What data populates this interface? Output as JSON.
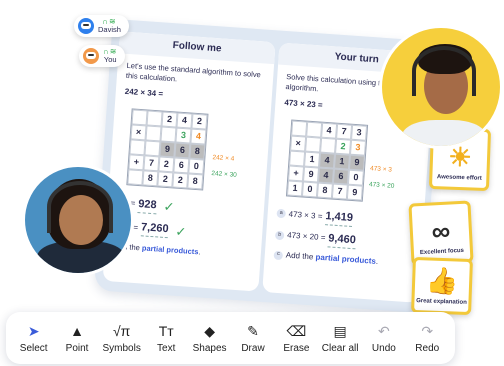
{
  "users": [
    {
      "name": "Davish",
      "color": "#2f80ed"
    },
    {
      "name": "You",
      "color": "#f2994a"
    }
  ],
  "left_panel": {
    "title": "Follow me",
    "instruction": "Let's use the standard algorithm to solve this calculation.",
    "calc": "242 × 34 =",
    "grid": [
      [
        "",
        "",
        "2",
        "4",
        "2"
      ],
      [
        "×",
        "",
        "",
        "3",
        "4"
      ],
      [
        "",
        "",
        "9",
        "6",
        "8"
      ],
      [
        "+",
        "7",
        "2",
        "6",
        "0"
      ],
      [
        "",
        "8",
        "2",
        "2",
        "8"
      ]
    ],
    "anno1": "242 × 4",
    "anno2": "242 × 30",
    "res1_expr": "× 4 =",
    "res1_val": "928",
    "res2_expr": "× 30 =",
    "res2_val": "7,260",
    "footer_pre": "Add the ",
    "footer_em": "partial products",
    "footer_post": "."
  },
  "right_panel": {
    "title": "Your turn",
    "instruction": "Solve this calculation using the standard algorithm.",
    "calc": "473 × 23 =",
    "grid": [
      [
        "",
        "",
        "4",
        "7",
        "3"
      ],
      [
        "×",
        "",
        "",
        "2",
        "3"
      ],
      [
        "",
        "1",
        "4",
        "1",
        "9"
      ],
      [
        "+",
        "9",
        "4",
        "6",
        "0"
      ],
      [
        "1",
        "0",
        "8",
        "7",
        "9"
      ]
    ],
    "anno1": "473 × 3",
    "anno2": "473 × 20",
    "results": [
      {
        "letter": "a",
        "expr": "473 × 3 =",
        "val": "1,419"
      },
      {
        "letter": "b",
        "expr": "473 × 20 =",
        "val": "9,460"
      }
    ],
    "footer_letter": "c",
    "footer_pre": "Add the ",
    "footer_em": "partial products",
    "footer_post": "."
  },
  "badges": [
    {
      "label": "Awesome effort",
      "icon": "sun-icon"
    },
    {
      "label": "Excellent focus",
      "icon": "binoculars-icon"
    },
    {
      "label": "Great explanation",
      "icon": "thumbs-up-icon"
    }
  ],
  "toolbar": [
    {
      "label": "Select",
      "icon": "cursor-icon",
      "glyph": "➤"
    },
    {
      "label": "Point",
      "icon": "pointer-icon",
      "glyph": "▲"
    },
    {
      "label": "Symbols",
      "icon": "sqrt-pi-icon",
      "glyph": "√π"
    },
    {
      "label": "Text",
      "icon": "text-icon",
      "glyph": "Tт"
    },
    {
      "label": "Shapes",
      "icon": "shapes-icon",
      "glyph": "◆"
    },
    {
      "label": "Draw",
      "icon": "pen-icon",
      "glyph": "✎"
    },
    {
      "label": "Erase",
      "icon": "eraser-icon",
      "glyph": "⌫"
    },
    {
      "label": "Clear all",
      "icon": "clear-icon",
      "glyph": "▤"
    },
    {
      "label": "Undo",
      "icon": "undo-icon",
      "glyph": "↶"
    },
    {
      "label": "Redo",
      "icon": "redo-icon",
      "glyph": "↷"
    }
  ]
}
